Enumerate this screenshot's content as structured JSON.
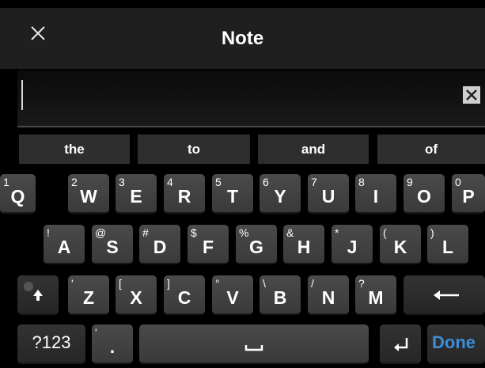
{
  "header": {
    "title": "Note",
    "close_icon": "close-icon"
  },
  "input": {
    "value": "",
    "clear_icon": "clear-x-box-icon"
  },
  "suggestions": [
    "the",
    "to",
    "and",
    "of"
  ],
  "row1": [
    {
      "sub": "1",
      "main": "Q"
    },
    {
      "sub": "2",
      "main": "W"
    },
    {
      "sub": "3",
      "main": "E"
    },
    {
      "sub": "4",
      "main": "R"
    },
    {
      "sub": "5",
      "main": "T"
    },
    {
      "sub": "6",
      "main": "Y"
    },
    {
      "sub": "7",
      "main": "U"
    },
    {
      "sub": "8",
      "main": "I"
    },
    {
      "sub": "9",
      "main": "O"
    },
    {
      "sub": "0",
      "main": "P"
    }
  ],
  "row2": [
    {
      "sub": "!",
      "main": "A"
    },
    {
      "sub": "@",
      "main": "S"
    },
    {
      "sub": "#",
      "main": "D"
    },
    {
      "sub": "$",
      "main": "F"
    },
    {
      "sub": "%",
      "main": "G"
    },
    {
      "sub": "&",
      "main": "H"
    },
    {
      "sub": "*",
      "main": "J"
    },
    {
      "sub": "(",
      "main": "K"
    },
    {
      "sub": ")",
      "main": "L"
    }
  ],
  "row3": [
    {
      "sub": "'",
      "main": "Z"
    },
    {
      "sub": "[",
      "main": "X"
    },
    {
      "sub": "]",
      "main": "C"
    },
    {
      "sub": "°",
      "main": "V"
    },
    {
      "sub": "\\",
      "main": "B"
    },
    {
      "sub": "/",
      "main": "N"
    },
    {
      "sub": "?",
      "main": "M"
    }
  ],
  "keys": {
    "shift_icon": "shift-arrow-icon",
    "backspace_icon": "backspace-arrow-icon",
    "symbols_label": "?123",
    "comma_sub": "'",
    "comma_main": ".",
    "space_icon": "space-bar-icon",
    "enter_icon": "enter-return-icon",
    "done_label": "Done"
  },
  "colors": {
    "done": "#3b8ed8",
    "header_bg": "#1f1f1f",
    "key_bg": "#444444"
  }
}
